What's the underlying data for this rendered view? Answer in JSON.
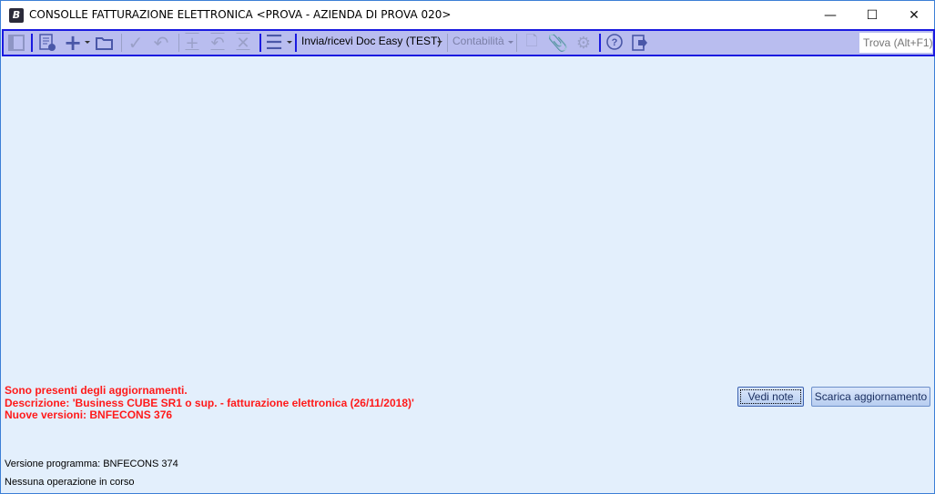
{
  "window": {
    "title": "CONSOLLE FATTURAZIONE ELETTRONICA <PROVA - AZIENDA DI PROVA 020>",
    "app_icon": "B",
    "minimize": "—",
    "maximize": "☐",
    "close": "✕"
  },
  "toolbar": {
    "menu_invia": "Invia/ricevi Doc Easy (TEST)",
    "menu_contabilita": "Contabilità",
    "search_placeholder": "Trova (Alt+F1)"
  },
  "updates": {
    "line1": "Sono presenti degli aggiornamenti.",
    "line2": "Descrizione: 'Business CUBE SR1 o sup. - fatturazione elettronica (26/11/2018)'",
    "line3": "Nuove versioni: BNFECONS 376",
    "btn_notes": "Vedi note",
    "btn_download": "Scarica aggiornamento"
  },
  "status": {
    "version": "Versione programma: BNFECONS 374",
    "operation": "Nessuna operazione in corso"
  },
  "colors": {
    "background": "#e3effc",
    "toolbar": "#b9bdef",
    "alert": "#ff1a1a"
  }
}
